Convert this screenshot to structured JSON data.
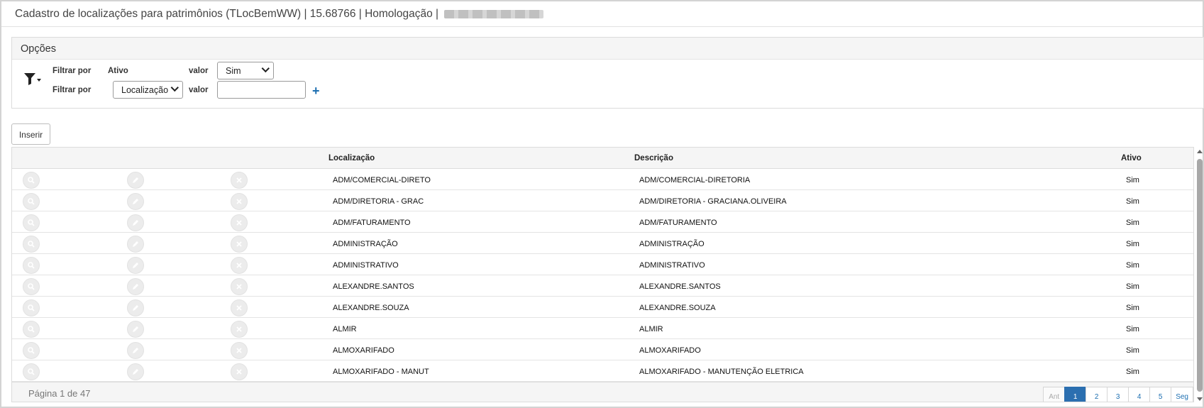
{
  "window": {
    "title": "Cadastro de localizações para patrimônios (TLocBemWW) | 15.68766 | Homologação |"
  },
  "options": {
    "header": "Opções",
    "filters": [
      {
        "label": "Filtrar por",
        "field": "Ativo",
        "value_label": "valor",
        "value": "Sim"
      },
      {
        "label": "Filtrar por",
        "field": "Localização",
        "value_label": "valor",
        "value": ""
      }
    ]
  },
  "toolbar": {
    "insert_label": "Inserir"
  },
  "table": {
    "columns": [
      "Localização",
      "Descrição",
      "Ativo"
    ],
    "rows": [
      {
        "loc": "ADM/COMERCIAL-DIRETO",
        "desc": "ADM/COMERCIAL-DIRETORIA",
        "ativo": "Sim"
      },
      {
        "loc": "ADM/DIRETORIA - GRAC",
        "desc": "ADM/DIRETORIA - GRACIANA.OLIVEIRA",
        "ativo": "Sim"
      },
      {
        "loc": "ADM/FATURAMENTO",
        "desc": "ADM/FATURAMENTO",
        "ativo": "Sim"
      },
      {
        "loc": "ADMINISTRAÇÃO",
        "desc": "ADMINISTRAÇÃO",
        "ativo": "Sim"
      },
      {
        "loc": "ADMINISTRATIVO",
        "desc": "ADMINISTRATIVO",
        "ativo": "Sim"
      },
      {
        "loc": "ALEXANDRE.SANTOS",
        "desc": "ALEXANDRE.SANTOS",
        "ativo": "Sim"
      },
      {
        "loc": "ALEXANDRE.SOUZA",
        "desc": "ALEXANDRE.SOUZA",
        "ativo": "Sim"
      },
      {
        "loc": "ALMIR",
        "desc": "ALMIR",
        "ativo": "Sim"
      },
      {
        "loc": "ALMOXARIFADO",
        "desc": "ALMOXARIFADO",
        "ativo": "Sim"
      },
      {
        "loc": "ALMOXARIFADO - MANUT",
        "desc": "ALMOXARIFADO - MANUTENÇÃO ELETRICA",
        "ativo": "Sim"
      }
    ]
  },
  "pagination": {
    "info": "Página 1 de 47",
    "prev": "Ant",
    "pages": [
      "1",
      "2",
      "3",
      "4",
      "5"
    ],
    "next": "Seg",
    "current": "1"
  },
  "icons": [
    "filter-icon",
    "chevron-down-icon",
    "plus-icon",
    "view-icon",
    "edit-icon",
    "delete-icon"
  ],
  "colors": {
    "accent": "#2b6fb0",
    "plus": "#1d6fb1"
  }
}
